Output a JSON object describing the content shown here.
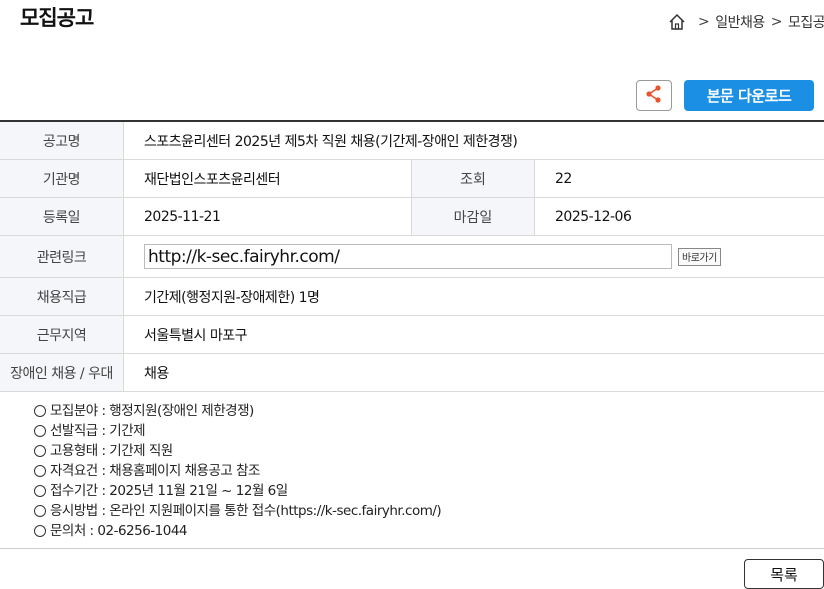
{
  "page": {
    "title": "모집공고"
  },
  "breadcrumb": {
    "items": [
      "일반채용",
      "모집공고"
    ],
    "separator": ">"
  },
  "actions": {
    "download_label": "본문 다운로드",
    "list_label": "목록"
  },
  "table": {
    "title_label": "공고명",
    "title_value": "스포츠윤리센터 2025년 제5차 직원 채용(기간제-장애인 제한경쟁)",
    "org_label": "기관명",
    "org_value": "재단법인스포츠윤리센터",
    "views_label": "조회",
    "views_value": "22",
    "reg_label": "등록일",
    "reg_value": "2025-11-21",
    "deadline_label": "마감일",
    "deadline_value": "2025-12-06",
    "link_label": "관련링크",
    "link_value": "http://k-sec.fairyhr.com/",
    "go_label": "바로가기",
    "position_label": "채용직급",
    "position_value": "기간제(행정지원-장애제한) 1명",
    "region_label": "근무지역",
    "region_value": "서울특별시 마포구",
    "disabled_label": "장애인 채용 / 우대",
    "disabled_value": "채용"
  },
  "details": [
    "모집분야 : 행정지원(장애인 제한경쟁)",
    "선발직급 : 기간제",
    "고용형태 : 기간제 직원",
    "자격요건 : 채용홈페이지 채용공고 참조",
    "접수기간 : 2025년 11월 21일 ~ 12월 6일",
    "응시방법 : 온라인 지원페이지를 통한 접수(https://k-sec.fairyhr.com/)",
    "문의처 : 02-6256-1044"
  ],
  "colors": {
    "accent": "#1a8fe3",
    "share_icon": "#e8542c",
    "label_bg": "#f4f6f9"
  },
  "icons": {
    "home": "home-icon",
    "share": "share-icon"
  }
}
